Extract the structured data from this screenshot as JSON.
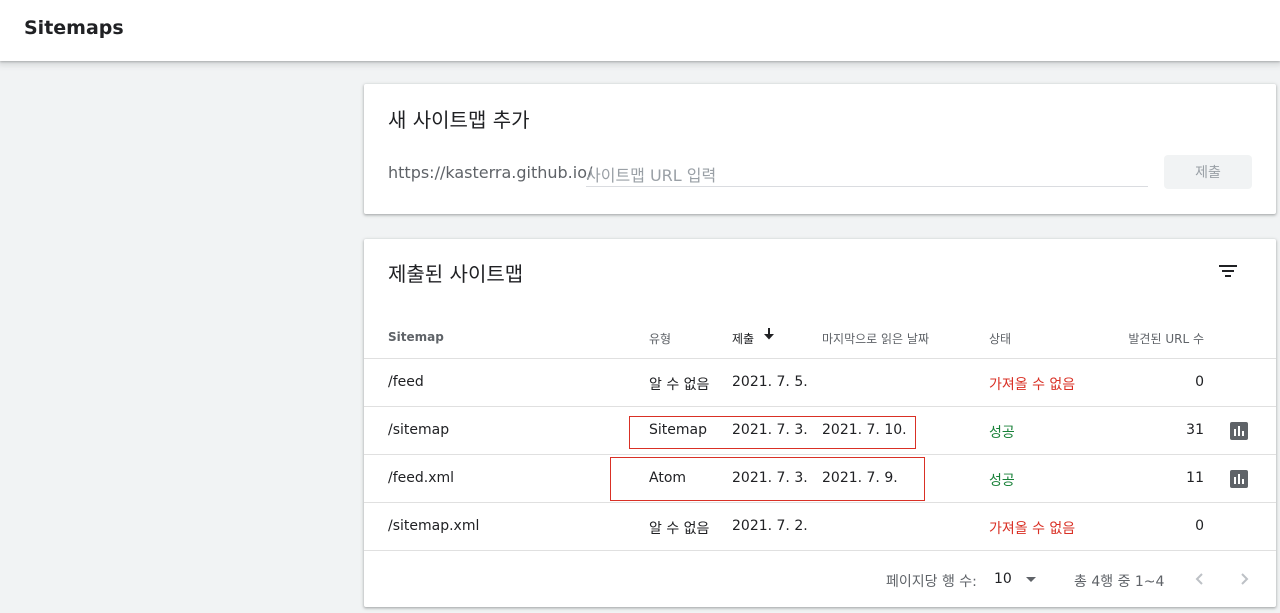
{
  "header": {
    "title": "Sitemaps"
  },
  "add_card": {
    "title": "새 사이트맵 추가",
    "url_prefix": "https://kasterra.github.io/",
    "input_placeholder": "사이트맵 URL 입력",
    "input_value": "",
    "submit_label": "제출"
  },
  "list_card": {
    "title": "제출된 사이트맵",
    "filter_icon": "filter-list-icon",
    "columns": {
      "sitemap": "Sitemap",
      "type": "유형",
      "submitted": "제출",
      "last_read": "마지막으로 읽은 날짜",
      "status": "상태",
      "discovered": "발견된 URL 수"
    },
    "sort_icon": "arrow-down-icon",
    "rows": [
      {
        "path": "/feed",
        "type": "알 수 없음",
        "submitted": "2021. 7. 5.",
        "last_read": "",
        "status": "가져올 수 없음",
        "count": "0"
      },
      {
        "path": "/sitemap",
        "type": "Sitemap",
        "submitted": "2021. 7. 3.",
        "last_read": "2021. 7. 10.",
        "status": "성공",
        "count": "31"
      },
      {
        "path": "/feed.xml",
        "type": "Atom",
        "submitted": "2021. 7. 3.",
        "last_read": "2021. 7. 9.",
        "status": "성공",
        "count": "11"
      },
      {
        "path": "/sitemap.xml",
        "type": "알 수 없음",
        "submitted": "2021. 7. 2.",
        "last_read": "",
        "status": "가져올 수 없음",
        "count": "0"
      }
    ],
    "pagination": {
      "rows_per_page_label": "페이지당 행 수:",
      "rows_per_page_value": "10",
      "range_label": "총 4행 중 1~4"
    }
  },
  "colors": {
    "status_error": "#d93025",
    "status_success": "#188038",
    "annotation_box": "#d93025"
  }
}
